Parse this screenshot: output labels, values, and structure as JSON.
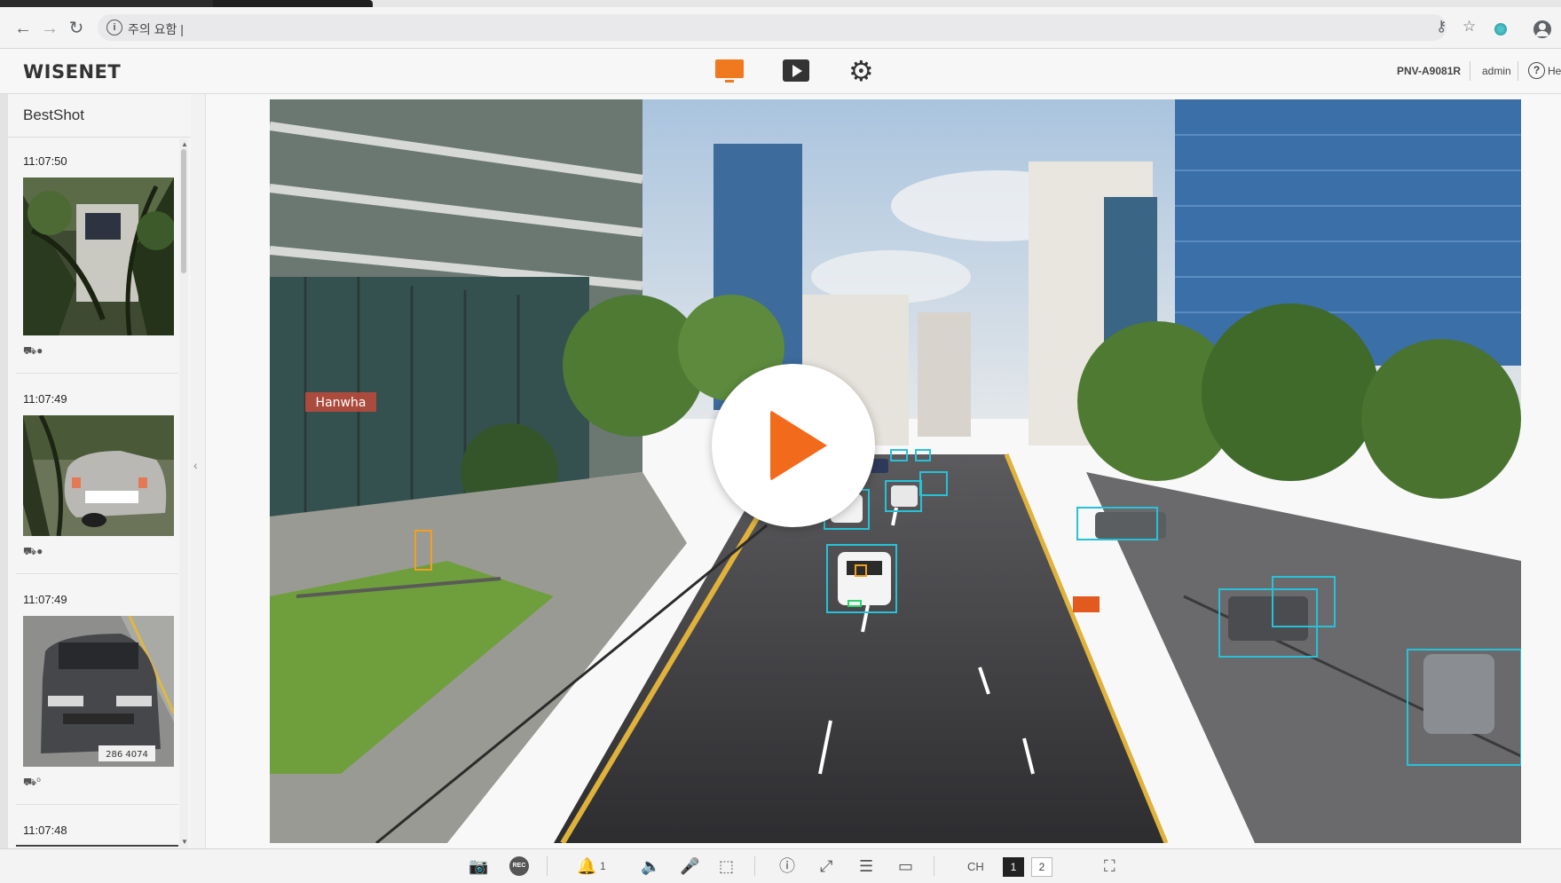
{
  "browser": {
    "url_text": "주의 요함 |",
    "back_icon": "arrow-left-icon",
    "forward_icon": "arrow-right-icon",
    "reload_icon": "reload-icon",
    "key_icon": "key-icon",
    "star_icon": "star-icon"
  },
  "app": {
    "logo": "WISENET",
    "model": "PNV-A9081R",
    "user": "admin",
    "help_label": "He",
    "accent_color": "#f0781e"
  },
  "sidebar": {
    "title": "BestShot",
    "items": [
      {
        "time": "11:07:50",
        "type_icon": "car-icon"
      },
      {
        "time": "11:07:49",
        "type_icon": "car-icon"
      },
      {
        "time": "11:07:49",
        "type_icon": "car-plate-icon"
      },
      {
        "time": "11:07:48"
      }
    ]
  },
  "video": {
    "brand_sign": "Hanwha",
    "plate_text": "286 4074",
    "play_overlay": "play-icon"
  },
  "toolbar": {
    "alarm_count": "1",
    "ch_label": "CH",
    "channels": [
      "1",
      "2"
    ]
  }
}
